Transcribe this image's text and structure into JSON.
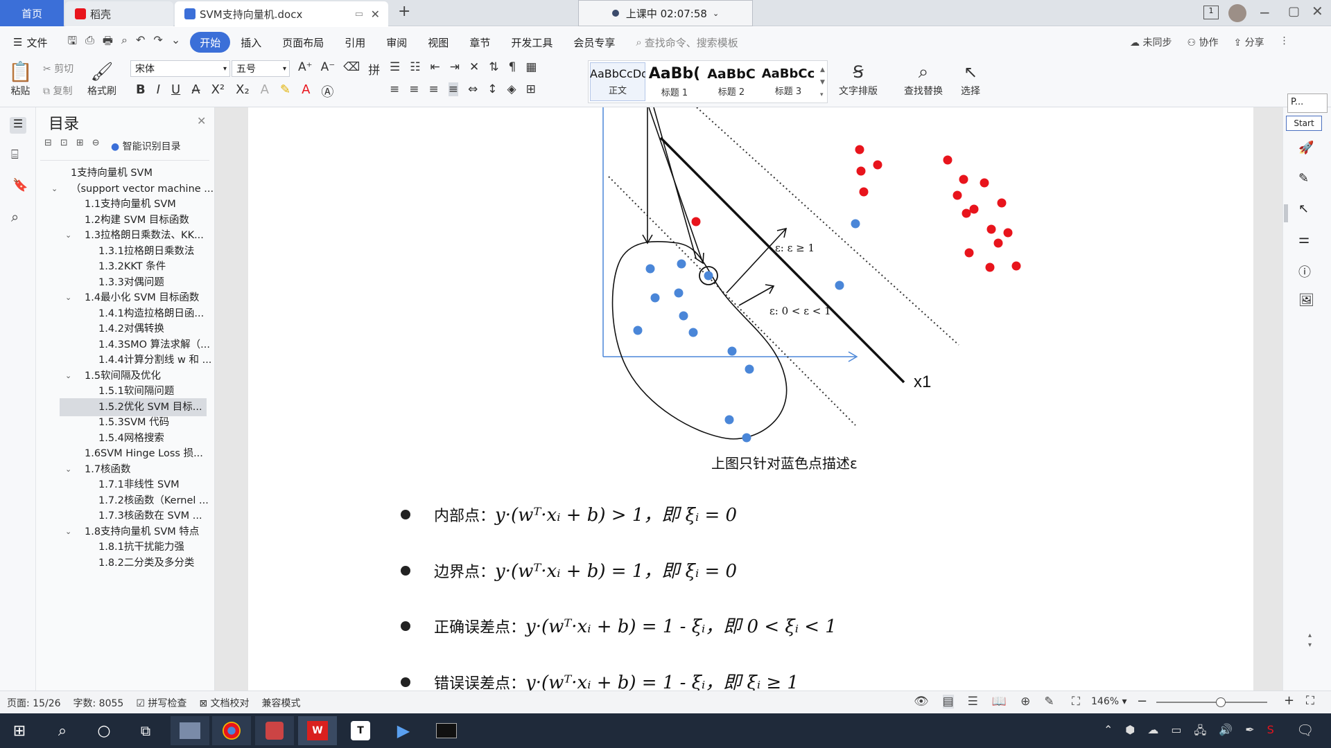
{
  "tabs": {
    "home": "首页",
    "shell": "稻壳",
    "doc": "SVM支持向量机.docx"
  },
  "timer": "上课中 02:07:58",
  "menu": [
    "文件",
    "开始",
    "插入",
    "页面布局",
    "引用",
    "审阅",
    "视图",
    "章节",
    "开发工具",
    "会员专享"
  ],
  "search_placeholder": "查找命令、搜索模板",
  "top_right": {
    "sync": "未同步",
    "collab": "协作",
    "share": "分享"
  },
  "ribbon": {
    "paste": "粘贴",
    "cut": "剪切",
    "copy": "复制",
    "format_painter": "格式刷",
    "font": "宋体",
    "size": "五号",
    "styles": [
      {
        "preview": "AaBbCcDd",
        "name": "正文"
      },
      {
        "preview": "AaBb(",
        "name": "标题 1"
      },
      {
        "preview": "AaBbC",
        "name": "标题 2"
      },
      {
        "preview": "AaBbCc",
        "name": "标题 3"
      }
    ],
    "text_layout": "文字排版",
    "find_replace": "查找替换",
    "select": "选择"
  },
  "toc": {
    "title": "目录",
    "smart": "智能识别目录",
    "items": [
      {
        "label": "1支持向量机 SVM",
        "level": 0,
        "toggle": ""
      },
      {
        "label": "（support vector machine ...",
        "level": 0,
        "toggle": "v"
      },
      {
        "label": "1.1支持向量机 SVM",
        "level": 1,
        "toggle": ""
      },
      {
        "label": "1.2构建 SVM 目标函数",
        "level": 1,
        "toggle": ""
      },
      {
        "label": "1.3拉格朗日乘数法、KK...",
        "level": 1,
        "toggle": "v"
      },
      {
        "label": "1.3.1拉格朗日乘数法",
        "level": 2,
        "toggle": ""
      },
      {
        "label": "1.3.2KKT 条件",
        "level": 2,
        "toggle": ""
      },
      {
        "label": "1.3.3对偶问题",
        "level": 2,
        "toggle": ""
      },
      {
        "label": "1.4最小化 SVM 目标函数",
        "level": 1,
        "toggle": "v"
      },
      {
        "label": "1.4.1构造拉格朗日函...",
        "level": 2,
        "toggle": ""
      },
      {
        "label": "1.4.2对偶转换",
        "level": 2,
        "toggle": ""
      },
      {
        "label": "1.4.3SMO 算法求解（...",
        "level": 2,
        "toggle": ""
      },
      {
        "label": "1.4.4计算分割线 w 和 ...",
        "level": 2,
        "toggle": ""
      },
      {
        "label": "1.5软间隔及优化",
        "level": 1,
        "toggle": "v"
      },
      {
        "label": "1.5.1软间隔问题",
        "level": 2,
        "toggle": ""
      },
      {
        "label": "1.5.2优化 SVM 目标...",
        "level": 2,
        "toggle": "",
        "selected": true
      },
      {
        "label": "1.5.3SVM 代码",
        "level": 2,
        "toggle": ""
      },
      {
        "label": "1.5.4网格搜索",
        "level": 2,
        "toggle": ""
      },
      {
        "label": "1.6SVM Hinge Loss 损...",
        "level": 1,
        "toggle": ""
      },
      {
        "label": "1.7核函数",
        "level": 1,
        "toggle": "v"
      },
      {
        "label": "1.7.1非线性 SVM",
        "level": 2,
        "toggle": ""
      },
      {
        "label": "1.7.2核函数（Kernel ...",
        "level": 2,
        "toggle": ""
      },
      {
        "label": "1.7.3核函数在 SVM ...",
        "level": 2,
        "toggle": ""
      },
      {
        "label": "1.8支持向量机 SVM 特点",
        "level": 1,
        "toggle": "v"
      },
      {
        "label": "1.8.1抗干扰能力强",
        "level": 2,
        "toggle": ""
      },
      {
        "label": "1.8.2二分类及多分类",
        "level": 2,
        "toggle": ""
      }
    ]
  },
  "figure": {
    "axis_label_x": "x1",
    "label_eps1": "ε: ε ≥ 1",
    "label_eps2": "ε: 0 < ε < 1",
    "caption": "上图只针对蓝色点描述ε",
    "colors": {
      "red": "#e8141c",
      "blue": "#4a86d8"
    }
  },
  "bullets": [
    {
      "name": "内部点：",
      "formula": "y·(wᵀ·xᵢ + b) > 1，即 ξᵢ = 0"
    },
    {
      "name": "边界点：",
      "formula": "y·(wᵀ·xᵢ + b) = 1，即 ξᵢ = 0"
    },
    {
      "name": "正确误差点：",
      "formula": "y·(wᵀ·xᵢ + b) = 1 - ξᵢ，即 0 < ξᵢ < 1"
    },
    {
      "name": "错误误差点：",
      "formula": "y·(wᵀ·xᵢ + b) = 1 - ξᵢ，即 ξᵢ ≥ 1"
    }
  ],
  "status": {
    "page": "页面: 15/26",
    "words": "字数: 8055",
    "spell": "拼写检查",
    "proof": "文档校对",
    "compat": "兼容模式",
    "zoom": "146%"
  },
  "rightbar": {
    "p_label": "P...",
    "start": "Start"
  }
}
